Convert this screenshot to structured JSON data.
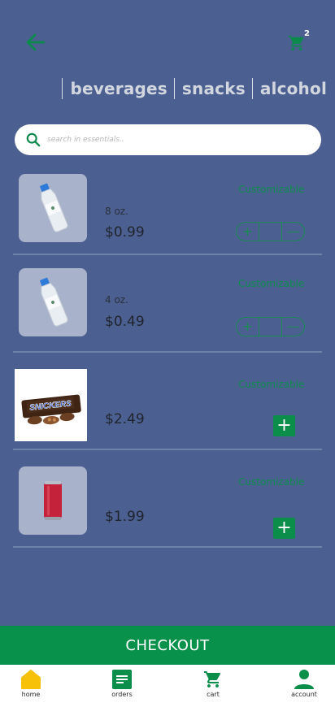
{
  "header": {
    "cart_count": "2",
    "back_icon": "arrow-left-icon",
    "cart_icon": "cart-icon"
  },
  "tabs": [
    "beverages",
    "snacks",
    "alcohol"
  ],
  "search": {
    "placeholder": "search in essentials.."
  },
  "products": [
    {
      "image": "water-bottle",
      "size": "8 oz.",
      "price": "$0.99",
      "customize": "Customizable",
      "control": "stepper"
    },
    {
      "image": "water-bottle",
      "size": "4 oz.",
      "price": "$0.49",
      "customize": "Customizable",
      "control": "stepper"
    },
    {
      "image": "snickers-bar",
      "size": "",
      "price": "$2.49",
      "customize": "Customizable",
      "control": "add"
    },
    {
      "image": "red-soda-can",
      "size": "",
      "price": "$1.99",
      "customize": "Customizable",
      "control": "add"
    }
  ],
  "stepper": {
    "plus": "+",
    "minus": "—"
  },
  "add_label": "+",
  "snickers_text": "SNICKERS",
  "checkout": "CHECKOUT",
  "nav": [
    {
      "label": "home",
      "icon": "home-icon"
    },
    {
      "label": "orders",
      "icon": "orders-icon"
    },
    {
      "label": "cart",
      "icon": "cart-icon"
    },
    {
      "label": "account",
      "icon": "account-icon"
    }
  ],
  "colors": {
    "background": "#4b6090",
    "accent_green": "#07914a",
    "home_yellow": "#f7c10a"
  }
}
